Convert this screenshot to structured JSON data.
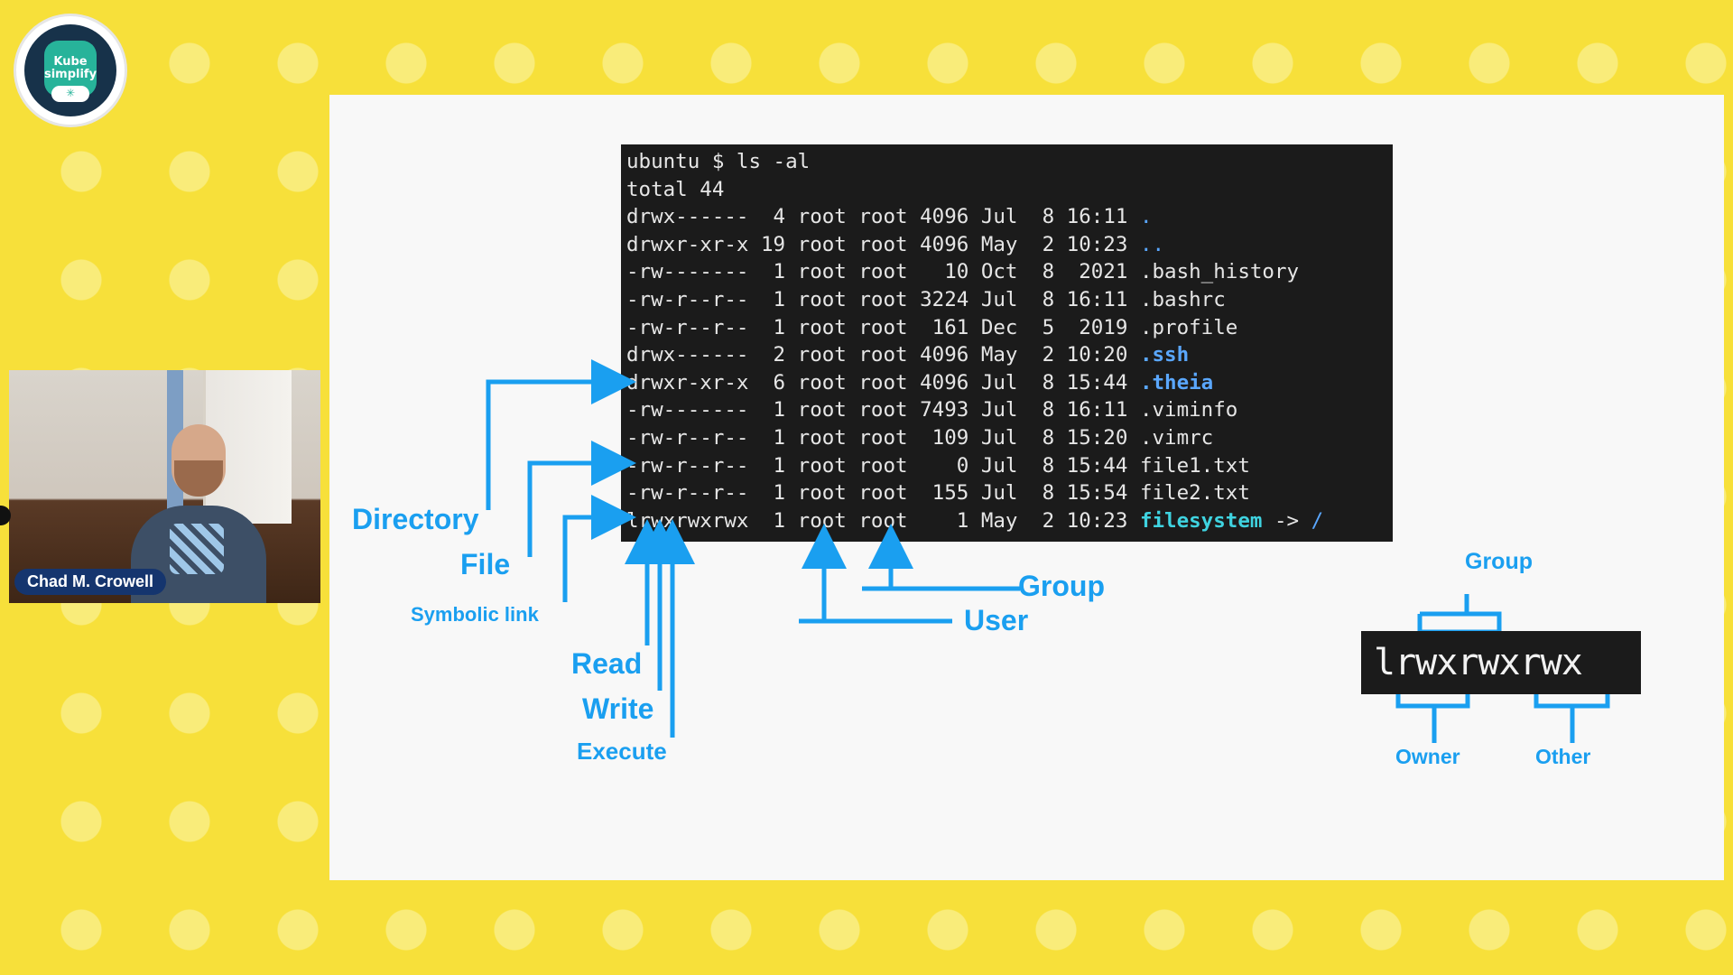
{
  "logo": {
    "line1": "Kube",
    "line2": "simplify"
  },
  "presenter": {
    "name": "Chad M. Crowell"
  },
  "terminal": {
    "lines": [
      [
        "ubuntu $ ls -al",
        "",
        ""
      ],
      [
        "total 44",
        "",
        ""
      ],
      [
        "drwx------  4 root root 4096 Jul  8 16:11 ",
        ".",
        "blue"
      ],
      [
        "drwxr-xr-x 19 root root 4096 May  2 10:23 ",
        "..",
        "blue"
      ],
      [
        "-rw-------  1 root root   10 Oct  8  2021 ",
        ".bash_history",
        ""
      ],
      [
        "-rw-r--r--  1 root root 3224 Jul  8 16:11 ",
        ".bashrc",
        ""
      ],
      [
        "-rw-r--r--  1 root root  161 Dec  5  2019 ",
        ".profile",
        ""
      ],
      [
        "drwx------  2 root root 4096 May  2 10:20 ",
        ".ssh",
        "blue-bold"
      ],
      [
        "drwxr-xr-x  6 root root 4096 Jul  8 15:44 ",
        ".theia",
        "blue-bold"
      ],
      [
        "-rw-------  1 root root 7493 Jul  8 16:11 ",
        ".viminfo",
        ""
      ],
      [
        "-rw-r--r--  1 root root  109 Jul  8 15:20 ",
        ".vimrc",
        ""
      ],
      [
        "-rw-r--r--  1 root root    0 Jul  8 15:44 ",
        "file1.txt",
        ""
      ],
      [
        "-rw-r--r--  1 root root  155 Jul  8 15:54 ",
        "file2.txt",
        ""
      ],
      [
        "lrwxrwxrwx  1 root root    1 May  2 10:23 ",
        "filesystem",
        "link"
      ]
    ],
    "link_arrow": " -> ",
    "link_target": "/"
  },
  "labels": {
    "directory": "Directory",
    "file": "File",
    "symbolic_link": "Symbolic link",
    "read": "Read",
    "write": "Write",
    "execute": "Execute",
    "group": "Group",
    "user": "User"
  },
  "perm_diagram": {
    "permissions": "lrwxrwxrwx",
    "group": "Group",
    "owner": "Owner",
    "other": "Other"
  },
  "colors": {
    "accent": "#1a9ff0",
    "background": "#f7e03a",
    "terminal_bg": "#1b1b1b",
    "dir_blue": "#5aa7ff",
    "link_cyan": "#3fd3e0"
  }
}
